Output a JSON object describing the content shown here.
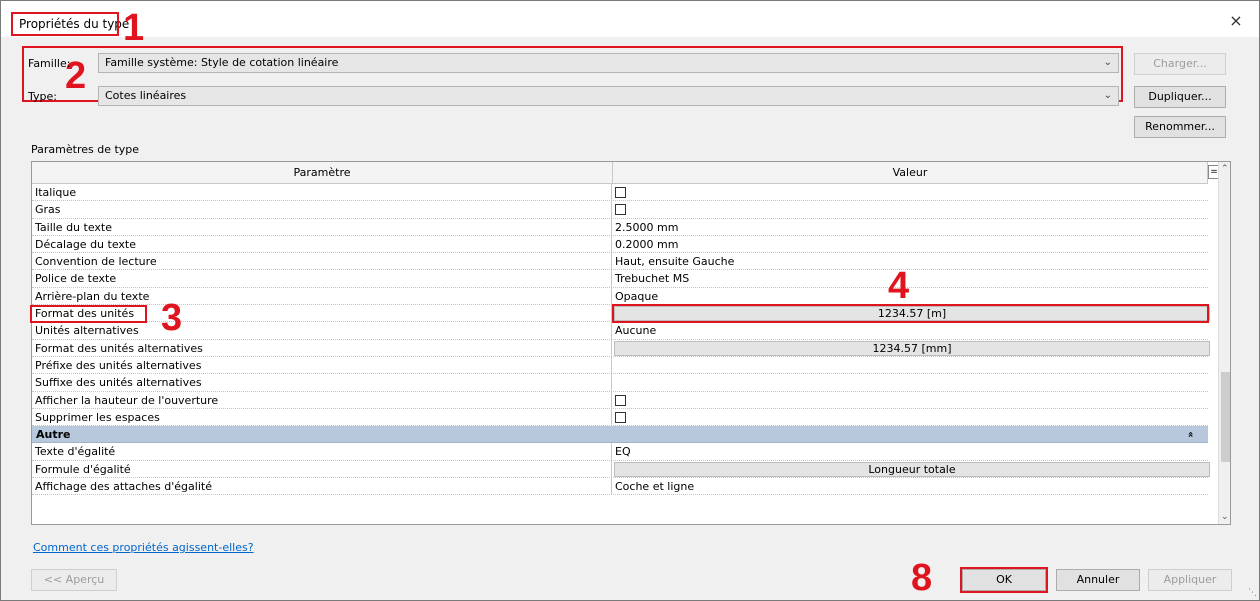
{
  "dialog": {
    "title": "Propriétés du type",
    "close_icon": "×"
  },
  "family": {
    "label": "Famille:",
    "value": "Famille système: Style de cotation linéaire"
  },
  "type": {
    "label": "Type:",
    "value": "Cotes linéaires"
  },
  "buttons": {
    "load": "Charger...",
    "duplicate": "Dupliquer...",
    "rename": "Renommer..."
  },
  "params_section": "Paramètres de type",
  "grid": {
    "headers": {
      "param": "Paramètre",
      "value": "Valeur"
    },
    "rows": [
      {
        "param": "Italique",
        "type": "checkbox"
      },
      {
        "param": "Gras",
        "type": "checkbox"
      },
      {
        "param": "Taille du texte",
        "type": "text",
        "value": "2.5000 mm"
      },
      {
        "param": "Décalage du texte",
        "type": "text",
        "value": "0.2000 mm"
      },
      {
        "param": "Convention de lecture",
        "type": "text",
        "value": "Haut, ensuite Gauche"
      },
      {
        "param": "Police de texte",
        "type": "text",
        "value": "Trebuchet MS"
      },
      {
        "param": "Arrière-plan du texte",
        "type": "text",
        "value": "Opaque"
      },
      {
        "param": "Format des unités",
        "type": "button",
        "value": "1234.57 [m]"
      },
      {
        "param": "Unités alternatives",
        "type": "text",
        "value": "Aucune"
      },
      {
        "param": "Format des unités alternatives",
        "type": "button",
        "value": "1234.57 [mm]"
      },
      {
        "param": "Préfixe des unités alternatives",
        "type": "text",
        "value": ""
      },
      {
        "param": "Suffixe des unités alternatives",
        "type": "text",
        "value": ""
      },
      {
        "param": "Afficher la hauteur de l'ouverture",
        "type": "checkbox"
      },
      {
        "param": "Supprimer les espaces",
        "type": "checkbox"
      },
      {
        "group": "Autre"
      },
      {
        "param": "Texte d'égalité",
        "type": "text",
        "value": "EQ"
      },
      {
        "param": "Formule d'égalité",
        "type": "button",
        "value": "Longueur totale"
      },
      {
        "param": "Affichage des attaches d'égalité",
        "type": "text",
        "value": "Coche et ligne"
      }
    ]
  },
  "help_link": "Comment ces propriétés agissent-elles?",
  "footer": {
    "preview": "<< Aperçu",
    "ok": "OK",
    "cancel": "Annuler",
    "apply": "Appliquer"
  },
  "callouts": {
    "c1": "1",
    "c2": "2",
    "c3": "3",
    "c4": "4",
    "c8": "8"
  },
  "colors": {
    "annotation_red": "#e0141e",
    "group_header": "#b7c7dc"
  }
}
